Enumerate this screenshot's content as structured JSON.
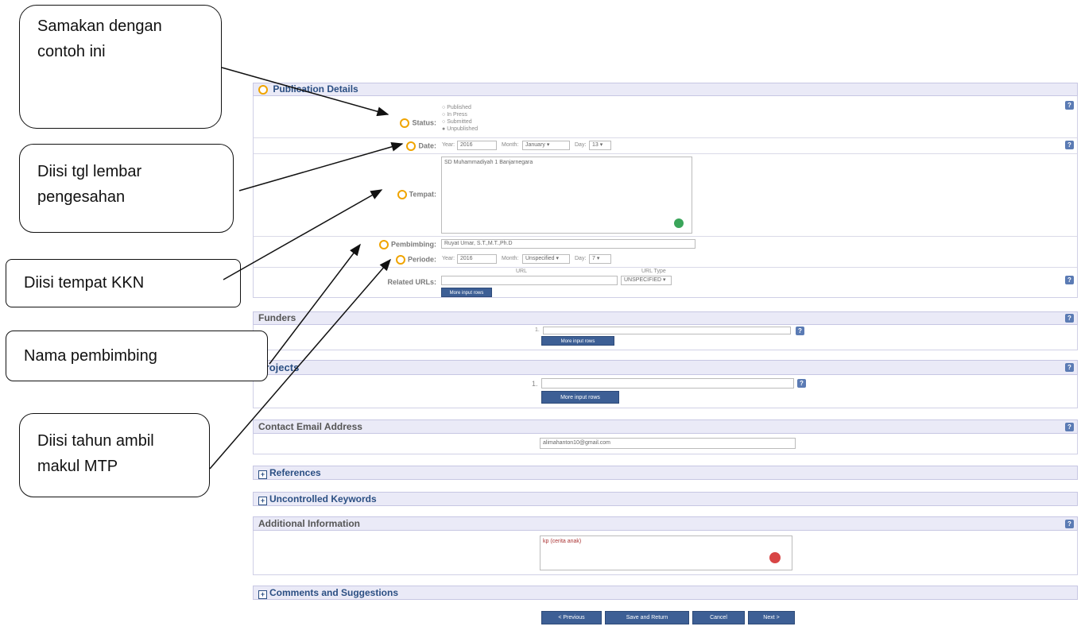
{
  "callouts": {
    "c1": "Samakan dengan contoh ini",
    "c2": "Diisi tgl lembar pengesahan",
    "c3": "Diisi tempat KKN",
    "c4": "Nama pembimbing",
    "c5": "Diisi tahun ambil makul MTP"
  },
  "pubdetails": {
    "title": "Publication Details",
    "status_label": "Status:",
    "status_options": [
      "Published",
      "In Press",
      "Submitted",
      "Unpublished"
    ],
    "date_label": "Date:",
    "year_label": "Year:",
    "year_value": "2016",
    "month_label": "Month:",
    "month_value": "January",
    "day_label": "Day:",
    "day_value": "13",
    "tempat_label": "Tempat:",
    "tempat_value": "SD Muhammadiyah 1 Banjarnegara",
    "pembimbing_label": "Pembimbing:",
    "pembimbing_value": "Ruyat Umar, S.T.,M.T.,Ph.D",
    "periode_label": "Periode:",
    "periode_year_value": "2016",
    "periode_month_value": "Unspecified",
    "periode_day_value": "7",
    "urls_label": "Related URLs:",
    "url_col": "URL",
    "url_type_col": "URL Type",
    "url_type_value": "UNSPECIFIED",
    "more_rows": "More input rows"
  },
  "funders": {
    "title": "Funders",
    "row_num": "1.",
    "more_rows": "More input rows"
  },
  "projects": {
    "title": "Projects",
    "row_num": "1.",
    "more_rows": "More input rows"
  },
  "contact": {
    "title": "Contact Email Address",
    "value": "alimahanton10@gmail.com"
  },
  "references": {
    "title": "References"
  },
  "keywords": {
    "title": "Uncontrolled Keywords"
  },
  "additional": {
    "title": "Additional Information",
    "value": "kp (cerita anak)"
  },
  "comments": {
    "title": "Comments and Suggestions"
  },
  "nav": {
    "previous": "< Previous",
    "save": "Save and Return",
    "cancel": "Cancel",
    "next": "Next >"
  },
  "colors": {
    "header_bg": "#eaeaf7",
    "header_text": "#2b4f83",
    "button": "#3d5f95",
    "ring": "#f0a400"
  }
}
